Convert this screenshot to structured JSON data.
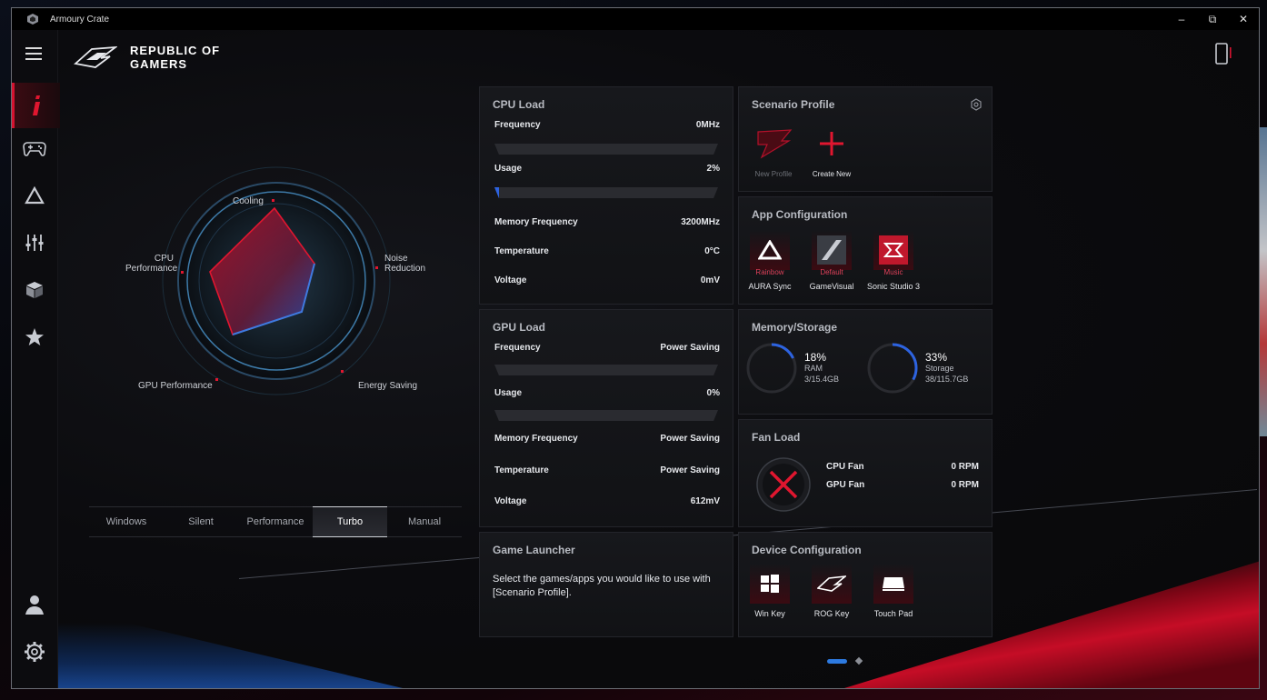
{
  "window": {
    "title": "Armoury Crate"
  },
  "header": {
    "brand_line1": "REPUBLIC OF",
    "brand_line2": "GAMERS"
  },
  "radar": {
    "labels": {
      "cooling": "Cooling",
      "noise": "Noise\nReduction",
      "energy": "Energy Saving",
      "gpu": "GPU Performance",
      "cpu": "CPU\nPerformance"
    }
  },
  "modes": {
    "items": [
      "Windows",
      "Silent",
      "Performance",
      "Turbo",
      "Manual"
    ],
    "selected": "Turbo"
  },
  "cpu_load": {
    "title": "CPU Load",
    "frequency_label": "Frequency",
    "frequency_value": "0MHz",
    "usage_label": "Usage",
    "usage_value": "2%",
    "usage_fraction": 0.02,
    "mem_freq_label": "Memory Frequency",
    "mem_freq_value": "3200MHz",
    "temp_label": "Temperature",
    "temp_value": "0°C",
    "voltage_label": "Voltage",
    "voltage_value": "0mV"
  },
  "gpu_load": {
    "title": "GPU Load",
    "frequency_label": "Frequency",
    "frequency_value": "Power Saving",
    "usage_label": "Usage",
    "usage_value": "0%",
    "usage_fraction": 0,
    "mem_freq_label": "Memory Frequency",
    "mem_freq_value": "Power Saving",
    "temp_label": "Temperature",
    "temp_value": "Power Saving",
    "voltage_label": "Voltage",
    "voltage_value": "612mV"
  },
  "game_launcher": {
    "title": "Game Launcher",
    "text": "Select the games/apps you would like to use with [Scenario Profile]."
  },
  "scenario_profile": {
    "title": "Scenario Profile",
    "new_profile": "New Profile",
    "create_new": "Create New"
  },
  "app_config": {
    "title": "App Configuration",
    "aura_sub": "Rainbow",
    "aura_name": "AURA Sync",
    "gamevisual_sub": "Default",
    "gamevisual_name": "GameVisual",
    "sonic_sub": "Music",
    "sonic_name": "Sonic Studio 3"
  },
  "memory_storage": {
    "title": "Memory/Storage",
    "ram_pct": "18%",
    "ram_label": "RAM",
    "ram_detail": "3/15.4GB",
    "ram_fraction": 0.18,
    "storage_pct": "33%",
    "storage_label": "Storage",
    "storage_detail": "38/115.7GB",
    "storage_fraction": 0.33
  },
  "fan_load": {
    "title": "Fan Load",
    "cpu_fan_label": "CPU Fan",
    "cpu_fan_value": "0 RPM",
    "gpu_fan_label": "GPU Fan",
    "gpu_fan_value": "0 RPM"
  },
  "device_config": {
    "title": "Device Configuration",
    "win_key": "Win Key",
    "rog_key": "ROG Key",
    "touch_pad": "Touch Pad"
  },
  "colors": {
    "accent_red": "#d51330",
    "accent_blue": "#2d63e0"
  }
}
